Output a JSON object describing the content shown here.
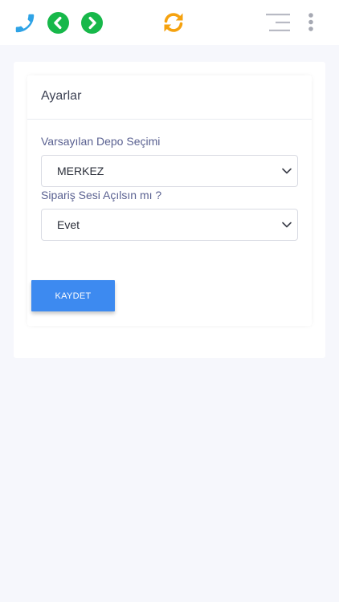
{
  "toolbar": {
    "icons": {
      "phone": "phone-icon",
      "back": "chevron-left-circle-icon",
      "forward": "chevron-right-circle-icon",
      "refresh": "refresh-icon",
      "menu": "menu-lines-icon",
      "more": "kebab-menu-icon"
    },
    "colors": {
      "phone": "#2fa3e6",
      "nav": "#17b84a",
      "refresh": "#f5a20f",
      "menu": "#b8bac4"
    }
  },
  "settings": {
    "title": "Ayarlar",
    "default_warehouse": {
      "label": "Varsayılan Depo Seçimi",
      "value": "MERKEZ"
    },
    "order_sound": {
      "label": "Sipariş Sesi Açılsın mı ?",
      "value": "Evet"
    },
    "save_label": "KAYDET"
  },
  "colors": {
    "accent": "#3d8af0",
    "background": "#f6f7fc"
  }
}
